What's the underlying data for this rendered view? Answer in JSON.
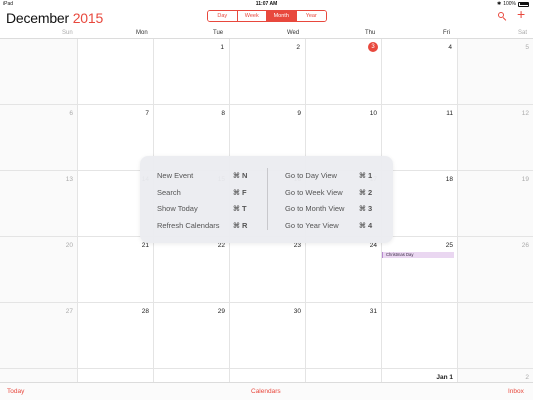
{
  "statusbar": {
    "carrier": "iPad",
    "time": "11:07 AM",
    "battery": "100%",
    "bluetooth": "✱"
  },
  "header": {
    "month": "December",
    "year": "2015",
    "segments": [
      {
        "label": "Day",
        "active": false
      },
      {
        "label": "Week",
        "active": false
      },
      {
        "label": "Month",
        "active": true
      },
      {
        "label": "Year",
        "active": false
      }
    ],
    "add_label": "+"
  },
  "weekdays": [
    "Sun",
    "Mon",
    "Tue",
    "Wed",
    "Thu",
    "Fri",
    "Sat"
  ],
  "weeks": [
    [
      "",
      "",
      "1",
      "2",
      "3",
      "4",
      "5"
    ],
    [
      "6",
      "7",
      "8",
      "9",
      "10",
      "11",
      "12"
    ],
    [
      "13",
      "14",
      "15",
      "16",
      "17",
      "18",
      "19"
    ],
    [
      "20",
      "21",
      "22",
      "23",
      "24",
      "25",
      "26"
    ],
    [
      "27",
      "28",
      "29",
      "30",
      "31",
      "",
      ""
    ],
    [
      "",
      "",
      "",
      "",
      "",
      "Jan 1",
      "2"
    ]
  ],
  "today": "3",
  "events": [
    {
      "date": "25",
      "title": "Christmas Day"
    }
  ],
  "shortcuts": {
    "left": [
      {
        "label": "New Event",
        "key": "⌘ N"
      },
      {
        "label": "Search",
        "key": "⌘ F"
      },
      {
        "label": "Show Today",
        "key": "⌘ T"
      },
      {
        "label": "Refresh Calendars",
        "key": "⌘ R"
      }
    ],
    "right": [
      {
        "label": "Go to Day View",
        "key": "⌘ 1"
      },
      {
        "label": "Go to Week View",
        "key": "⌘ 2"
      },
      {
        "label": "Go to Month View",
        "key": "⌘ 3"
      },
      {
        "label": "Go to Year View",
        "key": "⌘ 4"
      }
    ]
  },
  "tabbar": {
    "today": "Today",
    "calendars": "Calendars",
    "inbox": "Inbox"
  },
  "colors": {
    "accent": "#e8483d",
    "event_fill": "#ead7f1"
  }
}
